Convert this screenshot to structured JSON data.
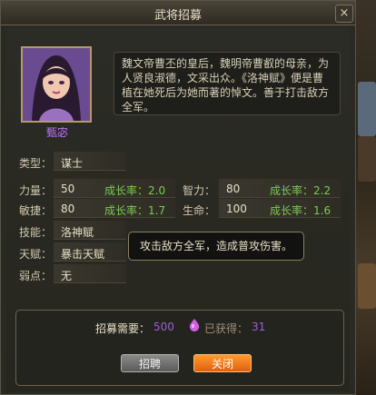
{
  "window": {
    "title": "武将招募",
    "close_glyph": "×"
  },
  "hero": {
    "name": "甄宓",
    "bio": "魏文帝曹丕的皇后，魏明帝曹叡的母亲，为人贤良淑德，文采出众。《洛神赋》便是曹植在她死后为她而著的悼文。善于打击敌方全军。"
  },
  "attributes": {
    "type_label": "类型：",
    "type_value": "谋士",
    "strength_label": "力量：",
    "strength_value": "50",
    "strength_growth": "成长率：2.0",
    "intellect_label": "智力：",
    "intellect_value": "80",
    "intellect_growth": "成长率：2.2",
    "agility_label": "敏捷：",
    "agility_value": "80",
    "agility_growth": "成长率：1.7",
    "life_label": "生命：",
    "life_value": "100",
    "life_growth": "成长率：1.6",
    "skill_label": "技能：",
    "skill_value": "洛神赋",
    "talent_label": "天赋：",
    "talent_value": "暴击天赋",
    "weakness_label": "弱点：",
    "weakness_value": "无"
  },
  "tooltip": {
    "text": "攻击敌方全军，造成普攻伤害。"
  },
  "recruit": {
    "need_label": "招募需要：",
    "need_value": "500",
    "have_label": "已获得：",
    "have_value": "31",
    "currency_icon": "soul-gem-icon",
    "recruit_button": "招聘",
    "close_button": "关闭"
  }
}
